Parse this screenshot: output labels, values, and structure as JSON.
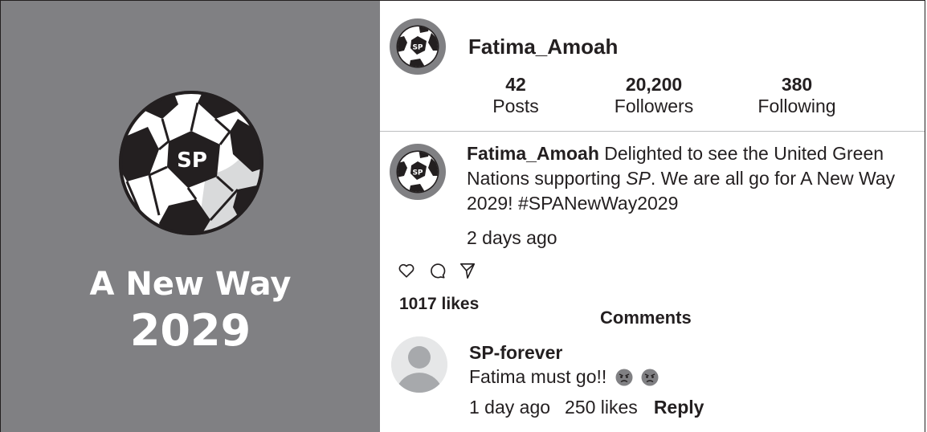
{
  "banner": {
    "ball_text": "SP",
    "slogan_line1": "A New Way",
    "slogan_line2": "2029"
  },
  "profile": {
    "username": "Fatima_Amoah",
    "avatar_text": "SP",
    "stats": [
      {
        "value": "42",
        "label": "Posts"
      },
      {
        "value": "20,200",
        "label": "Followers"
      },
      {
        "value": "380",
        "label": "Following"
      }
    ]
  },
  "post": {
    "author": "Fatima_Amoah",
    "text_before": " Delighted to see the United Green Nations supporting ",
    "text_italic": "SP",
    "text_after": ". We are all go for A New Way 2029! #SPANewWay2029",
    "time": "2 days ago",
    "likes": "1017 likes",
    "icons": [
      "heart-icon",
      "comment-icon",
      "share-icon"
    ]
  },
  "comments": {
    "title": "Comments",
    "items": [
      {
        "user": "SP-forever",
        "text": "Fatima must go!!",
        "emojis": [
          "angry-face-icon",
          "angry-face-icon"
        ],
        "time": "1 day ago",
        "likes": "250 likes",
        "reply_label": "Reply"
      }
    ]
  },
  "colors": {
    "panel_gray": "#808083",
    "text": "#231f20",
    "divider": "#bcbec0"
  }
}
